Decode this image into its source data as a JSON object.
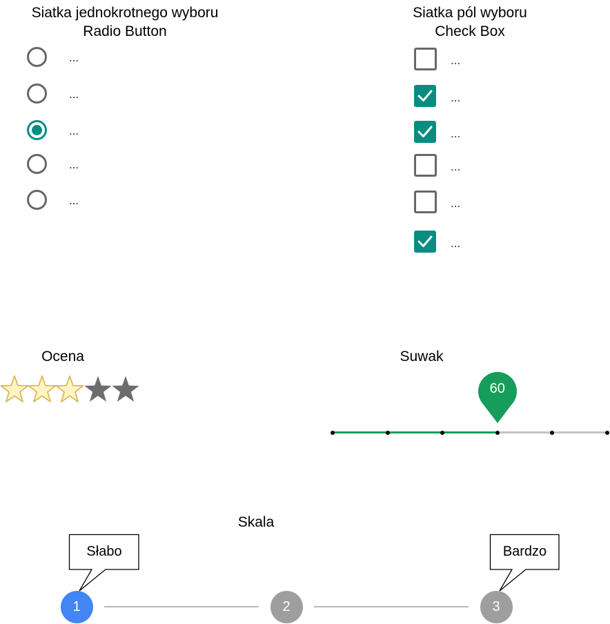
{
  "radio_section": {
    "title_line1": "Siatka jednokrotnego wyboru",
    "title_line2": "Radio Button",
    "options": [
      {
        "label": "...",
        "selected": false
      },
      {
        "label": "...",
        "selected": false
      },
      {
        "label": "...",
        "selected": true
      },
      {
        "label": "...",
        "selected": false
      },
      {
        "label": "...",
        "selected": false
      }
    ]
  },
  "checkbox_section": {
    "title_line1": "Siatka pól wyboru",
    "title_line2": "Check Box",
    "options": [
      {
        "label": "...",
        "checked": false
      },
      {
        "label": "...",
        "checked": true
      },
      {
        "label": "...",
        "checked": true
      },
      {
        "label": "...",
        "checked": false
      },
      {
        "label": "...",
        "checked": false
      },
      {
        "label": "...",
        "checked": true
      }
    ]
  },
  "rating_section": {
    "title": "Ocena",
    "rating": 3,
    "max": 5
  },
  "slider_section": {
    "title": "Suwak",
    "value_label": "60",
    "value_fraction": 0.6,
    "steps": 5
  },
  "scale_section": {
    "title": "Skala",
    "steps": [
      "1",
      "2",
      "3"
    ],
    "active_step": "1",
    "low_label": "Słabo",
    "high_label": "Bardzo"
  },
  "colors": {
    "accent_teal": "#098d80",
    "slider_green": "#169c5b",
    "scale_active_blue": "#4285f4",
    "inactive_gray": "#9e9e9e",
    "star_filled": "#fff4c2",
    "star_outline": "#d6b656",
    "star_empty": "#6d6d6d"
  }
}
